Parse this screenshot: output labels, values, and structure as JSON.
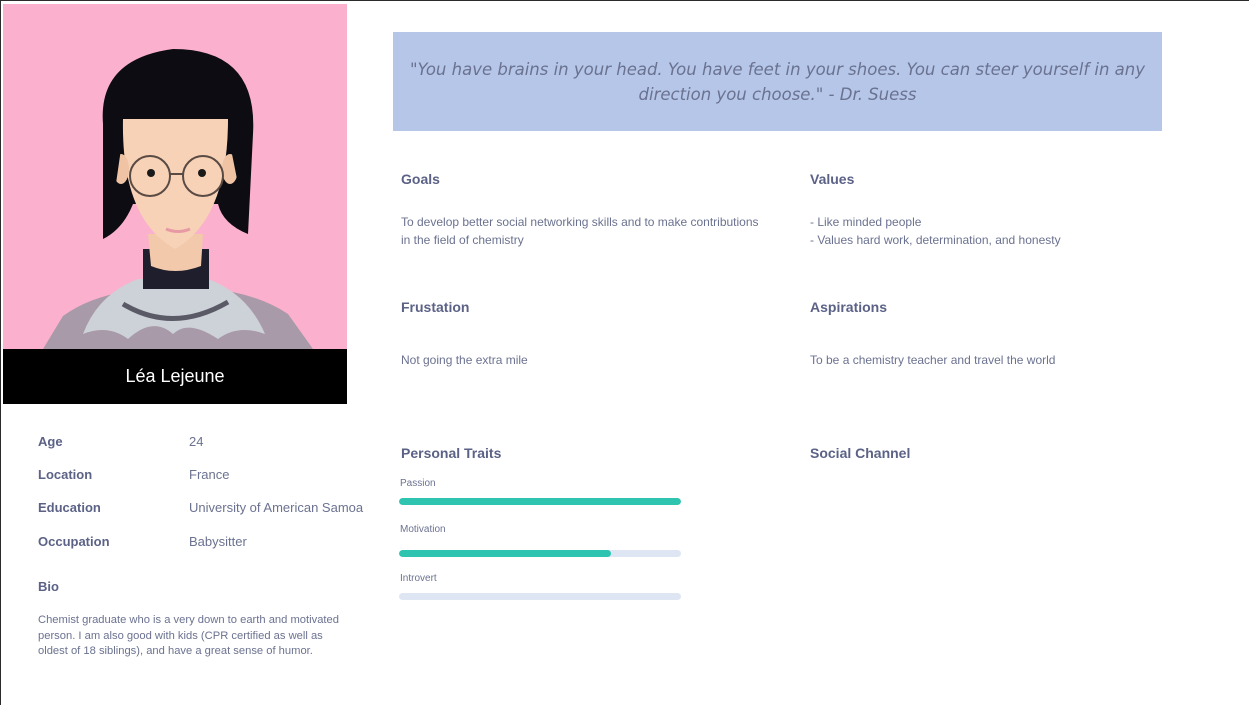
{
  "persona": {
    "name": "Léa Lejeune",
    "details": [
      {
        "label": "Age",
        "value": "24"
      },
      {
        "label": "Location",
        "value": "France"
      },
      {
        "label": "Education",
        "value": "University of American Samoa"
      },
      {
        "label": "Occupation",
        "value": "Babysitter"
      }
    ],
    "bio_title": "Bio",
    "bio": "Chemist graduate who is a very down to earth and motivated person. I am also good with kids (CPR certified as well as oldest of 18 siblings), and have a great sense of humor."
  },
  "quote": "\"You have brains in your head. You have feet in your shoes. You can steer yourself in any direction you choose.\" - Dr. Suess",
  "goals": {
    "title": "Goals",
    "text": "To develop better social networking skills and to make contributions in the field of chemistry"
  },
  "values": {
    "title": "Values",
    "lines": [
      "- Like minded people",
      "- Values hard work, determination, and honesty"
    ]
  },
  "frustration": {
    "title": "Frustation",
    "text": "Not going the extra mile"
  },
  "aspirations": {
    "title": "Aspirations",
    "text": "To be a chemistry teacher and travel the world"
  },
  "personal_traits": {
    "title": "Personal Traits",
    "traits": [
      {
        "label": "Passion",
        "level": 1.0
      },
      {
        "label": "Motivation",
        "level": 0.75
      },
      {
        "label": "Introvert",
        "level": 0.0
      }
    ]
  },
  "social_channel": {
    "title": "Social Channel"
  },
  "colors": {
    "portrait_bg": "#fbb0cd",
    "quote_bg": "#b5c6e8",
    "bar_fill": "#2ec4b0",
    "bar_track": "#dfe6f3"
  }
}
